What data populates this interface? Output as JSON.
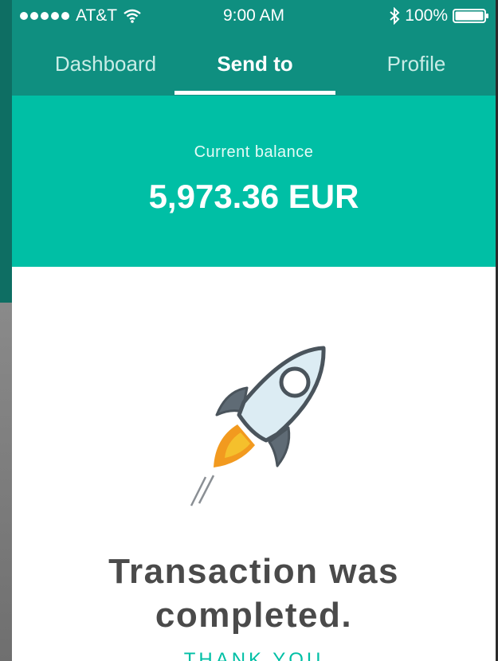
{
  "status_bar": {
    "carrier": "AT&T",
    "time": "9:00 AM",
    "battery": "100%",
    "icons": [
      "signal-dots-icon",
      "wifi-icon",
      "bluetooth-icon",
      "battery-icon"
    ]
  },
  "tabs": [
    {
      "label": "Dashboard",
      "active": false
    },
    {
      "label": "Send to",
      "active": true
    },
    {
      "label": "Profile",
      "active": false
    }
  ],
  "balance": {
    "label": "Current balance",
    "amount": "5,973.36 EUR"
  },
  "content": {
    "icon": "rocket-icon",
    "message_line1": "Transaction was",
    "message_line2": "completed.",
    "thanks": "THANK YOU"
  },
  "colors": {
    "header": "#0f8f80",
    "accent": "#00bfa5",
    "text": "#4a4a4a"
  }
}
